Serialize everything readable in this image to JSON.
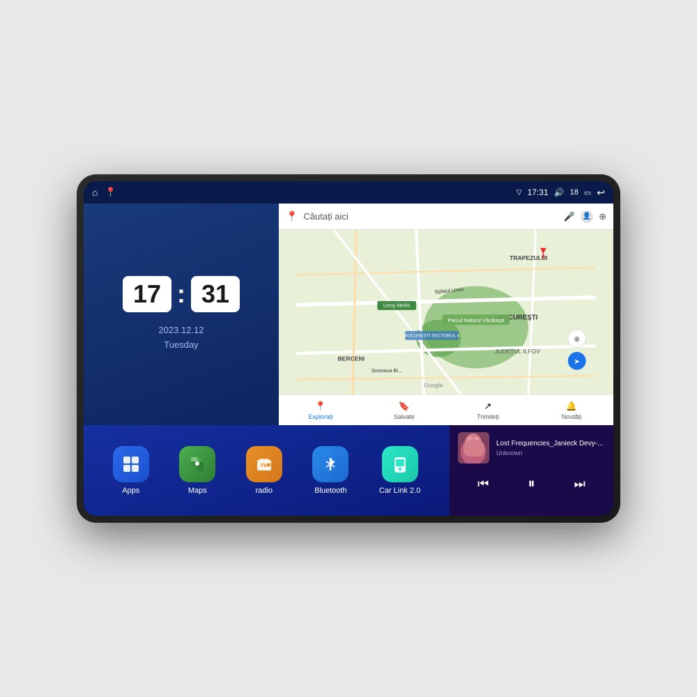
{
  "device": {
    "screen": {
      "statusBar": {
        "leftIcons": [
          "home-icon",
          "maps-shortcut-icon"
        ],
        "signal": "▽",
        "time": "17:31",
        "volume": "🔊",
        "batteryLevel": "18",
        "battery": "🔋",
        "back": "↩"
      }
    },
    "clock": {
      "hours": "17",
      "minutes": "31",
      "date": "2023.12.12",
      "day": "Tuesday"
    },
    "map": {
      "searchPlaceholder": "Căutați aici",
      "navItems": [
        {
          "label": "Explorați",
          "active": true
        },
        {
          "label": "Salvate",
          "active": false
        },
        {
          "label": "Trimiteți",
          "active": false
        },
        {
          "label": "Noutăți",
          "active": false
        }
      ],
      "labels": [
        "TRAPEZULUI",
        "BUCUREȘTI",
        "JUDEȚUL ILFOV",
        "BERCENI",
        "Leroy Merlin",
        "Parcul Natural Văcărești",
        "BUCUREȘTI SECTORUL 4"
      ]
    },
    "apps": [
      {
        "id": "apps",
        "label": "Apps",
        "iconClass": "icon-apps",
        "icon": "⊞"
      },
      {
        "id": "maps",
        "label": "Maps",
        "iconClass": "icon-maps",
        "icon": "📍"
      },
      {
        "id": "radio",
        "label": "radio",
        "iconClass": "icon-radio",
        "icon": "📻"
      },
      {
        "id": "bluetooth",
        "label": "Bluetooth",
        "iconClass": "icon-bluetooth",
        "icon": "⚡"
      },
      {
        "id": "carlink",
        "label": "Car Link 2.0",
        "iconClass": "icon-carlink",
        "icon": "📱"
      }
    ],
    "music": {
      "title": "Lost Frequencies_Janieck Devy-...",
      "artist": "Unknown",
      "controls": {
        "prev": "⏮",
        "play": "⏸",
        "next": "⏭"
      }
    }
  }
}
